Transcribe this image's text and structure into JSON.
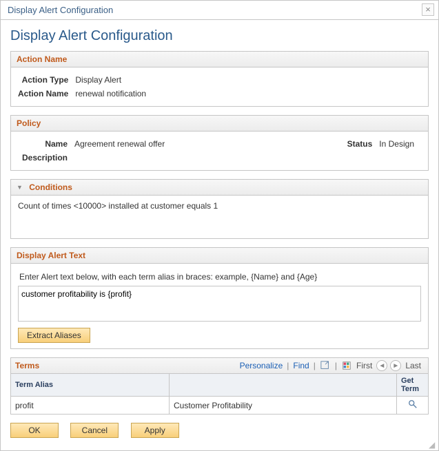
{
  "window": {
    "title": "Display Alert Configuration"
  },
  "page": {
    "title": "Display Alert Configuration"
  },
  "actionName": {
    "heading": "Action Name",
    "typeLabel": "Action Type",
    "typeValue": "Display Alert",
    "nameLabel": "Action Name",
    "nameValue": "renewal notification"
  },
  "policy": {
    "heading": "Policy",
    "nameLabel": "Name",
    "nameValue": "Agreement renewal offer",
    "statusLabel": "Status",
    "statusValue": "In Design",
    "descLabel": "Description",
    "descValue": ""
  },
  "conditions": {
    "heading": "Conditions",
    "text": "Count of times <10000> installed at customer equals 1"
  },
  "alertText": {
    "heading": "Display Alert Text",
    "instruction": "Enter Alert text below, with each term alias in braces: example, {Name} and {Age}",
    "value": "customer profitability is {profit}",
    "extractLabel": "Extract Aliases"
  },
  "termsGrid": {
    "heading": "Terms",
    "personalize": "Personalize",
    "find": "Find",
    "first": "First",
    "last": "Last",
    "colAlias": "Term Alias",
    "colGetTerm": "Get Term",
    "rows": [
      {
        "alias": "profit",
        "term": "Customer Profitability"
      }
    ]
  },
  "footer": {
    "ok": "OK",
    "cancel": "Cancel",
    "apply": "Apply"
  }
}
